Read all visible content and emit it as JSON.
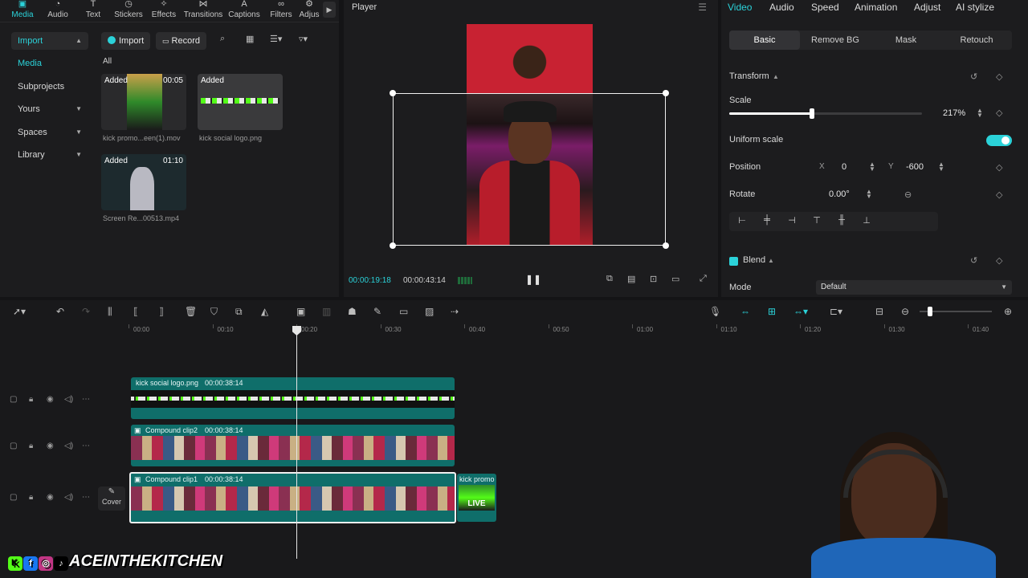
{
  "top_tabs": [
    {
      "label": "Media",
      "icon": "media-icon"
    },
    {
      "label": "Audio",
      "icon": "audio-icon"
    },
    {
      "label": "Text",
      "icon": "text-icon"
    },
    {
      "label": "Stickers",
      "icon": "stickers-icon"
    },
    {
      "label": "Effects",
      "icon": "effects-icon"
    },
    {
      "label": "Transitions",
      "icon": "transitions-icon"
    },
    {
      "label": "Captions",
      "icon": "captions-icon"
    },
    {
      "label": "Filters",
      "icon": "filters-icon"
    },
    {
      "label": "Adjus",
      "icon": "adjust-icon"
    }
  ],
  "nav": {
    "items": [
      {
        "label": "Import"
      },
      {
        "label": "Media"
      },
      {
        "label": "Subprojects"
      },
      {
        "label": "Yours"
      },
      {
        "label": "Spaces"
      },
      {
        "label": "Library"
      }
    ]
  },
  "media": {
    "import_label": "Import",
    "record_label": "Record",
    "filter_all": "All",
    "items": [
      {
        "badge": "Added",
        "duration": "00:05",
        "name": "kick promo...een(1).mov"
      },
      {
        "badge": "Added",
        "duration": "",
        "name": "kick social logo.png"
      },
      {
        "badge": "Added",
        "duration": "01:10",
        "name": "Screen Re...00513.mp4"
      }
    ]
  },
  "player": {
    "title": "Player",
    "current_time": "00:00:19:18",
    "total_time": "00:00:43:14"
  },
  "right": {
    "tabs": [
      "Video",
      "Audio",
      "Speed",
      "Animation",
      "Adjust",
      "AI stylize"
    ],
    "subtabs": [
      "Basic",
      "Remove BG",
      "Mask",
      "Retouch"
    ],
    "transform_label": "Transform",
    "scale_label": "Scale",
    "scale_value": "217%",
    "scale_fraction": 0.43,
    "uniform_label": "Uniform scale",
    "position_label": "Position",
    "pos_x_label": "X",
    "pos_x": "0",
    "pos_y_label": "Y",
    "pos_y": "-600",
    "rotate_label": "Rotate",
    "rotate_value": "0.00°",
    "blend_label": "Blend",
    "mode_label": "Mode",
    "mode_value": "Default"
  },
  "timeline": {
    "ruler": [
      "00:00",
      "00:10",
      "00:20",
      "00:30",
      "00:40",
      "00:50",
      "01:00",
      "01:10",
      "01:20",
      "01:30",
      "01:40"
    ],
    "tracks": [
      {
        "label": "kick social logo.png",
        "duration": "00:00:38:14"
      },
      {
        "label": "Compound clip2",
        "duration": "00:00:38:14"
      },
      {
        "label": "Compound clip1",
        "duration": "00:00:38:14"
      }
    ],
    "extra_clip_label": "kick promo",
    "extra_clip_text": "LIVE",
    "cover_label": "Cover"
  },
  "watermark": "ACEINTHEKITCHEN",
  "colors": {
    "accent": "#2bd2d9",
    "clip": "#0f6e6a"
  }
}
